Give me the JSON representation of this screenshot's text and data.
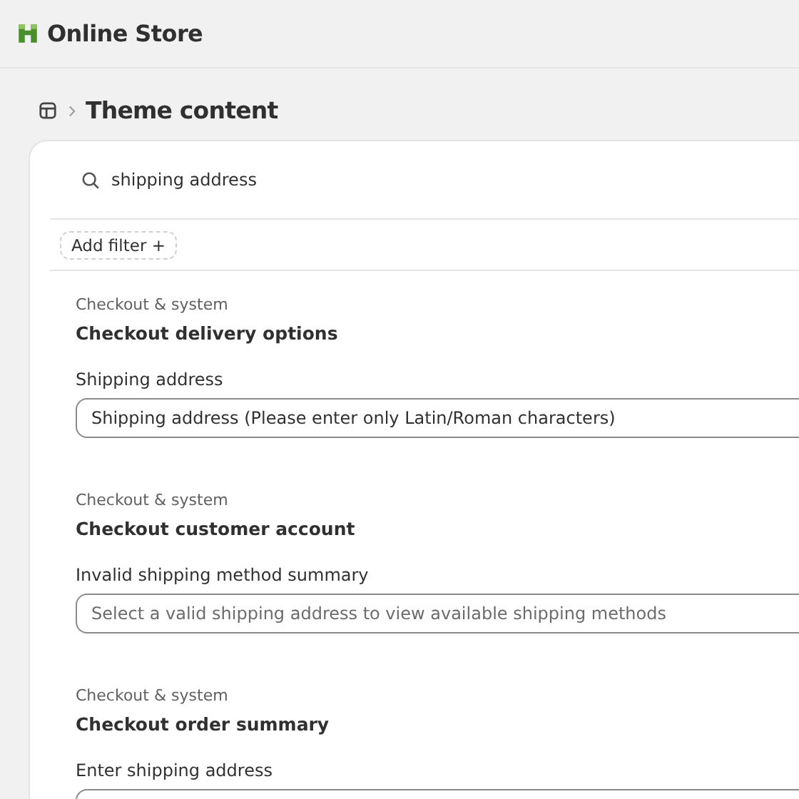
{
  "header": {
    "title": "Online Store"
  },
  "breadcrumb": {
    "title": "Theme content"
  },
  "search": {
    "value": "shipping address"
  },
  "filter_button": {
    "label": "Add filter +"
  },
  "sections": [
    {
      "category": "Checkout & system",
      "title": "Checkout delivery options",
      "field_label": "Shipping address",
      "value": "Shipping address (Please enter only Latin/Roman characters)"
    },
    {
      "category": "Checkout & system",
      "title": "Checkout customer account",
      "field_label": "Invalid shipping method summary",
      "placeholder": "Select a valid shipping address to view available shipping methods"
    },
    {
      "category": "Checkout & system",
      "title": "Checkout order summary",
      "field_label": "Enter shipping address"
    }
  ]
}
